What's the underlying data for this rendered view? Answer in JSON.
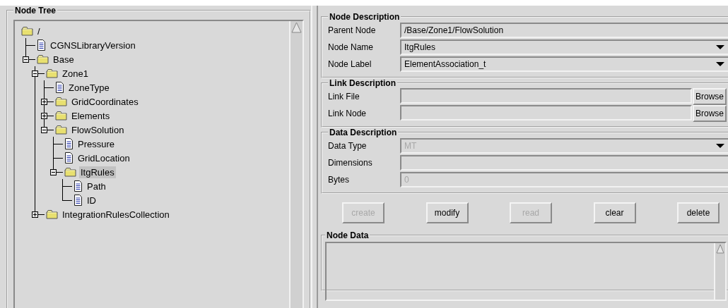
{
  "node_tree": {
    "title": "Node Tree",
    "nodes": [
      {
        "label": "/",
        "kind": "folder",
        "selected": false,
        "children": [
          {
            "label": "CGNSLibraryVersion",
            "kind": "file",
            "selected": false
          },
          {
            "label": "Base",
            "kind": "folder",
            "selected": false,
            "expanded": true,
            "children": [
              {
                "label": "Zone1",
                "kind": "folder",
                "selected": false,
                "expanded": true,
                "children": [
                  {
                    "label": "ZoneType",
                    "kind": "file",
                    "selected": false
                  },
                  {
                    "label": "GridCoordinates",
                    "kind": "folder",
                    "selected": false,
                    "expanded": false
                  },
                  {
                    "label": "Elements",
                    "kind": "folder",
                    "selected": false,
                    "expanded": false
                  },
                  {
                    "label": "FlowSolution",
                    "kind": "folder",
                    "selected": false,
                    "expanded": true,
                    "children": [
                      {
                        "label": "Pressure",
                        "kind": "file",
                        "selected": false
                      },
                      {
                        "label": "GridLocation",
                        "kind": "file",
                        "selected": false
                      },
                      {
                        "label": "ItgRules",
                        "kind": "folder",
                        "selected": true,
                        "expanded": true,
                        "children": [
                          {
                            "label": "Path",
                            "kind": "file",
                            "selected": false
                          },
                          {
                            "label": "ID",
                            "kind": "file",
                            "selected": false
                          }
                        ]
                      }
                    ]
                  }
                ]
              },
              {
                "label": "IntegrationRulesCollection",
                "kind": "folder",
                "selected": false,
                "expanded": false
              }
            ]
          }
        ]
      }
    ]
  },
  "node_description": {
    "title": "Node Description",
    "fields": [
      {
        "label": "Parent Node",
        "kind": "text",
        "value": "/Base/Zone1/FlowSolution",
        "disabled": false
      },
      {
        "label": "Node Name",
        "kind": "combo",
        "value": "ItgRules",
        "disabled": false
      },
      {
        "label": "Node Label",
        "kind": "combo",
        "value": "ElementAssociation_t",
        "disabled": false
      }
    ]
  },
  "link_description": {
    "title": "Link Description",
    "fields": [
      {
        "label": "Link File",
        "kind": "browse",
        "button": "Browse"
      },
      {
        "label": "Link Node",
        "kind": "browse",
        "button": "Browse"
      }
    ]
  },
  "data_description": {
    "title": "Data Description",
    "fields": [
      {
        "label": "Data Type",
        "kind": "combo",
        "value": "MT",
        "disabled": true
      },
      {
        "label": "Dimensions",
        "kind": "text"
      },
      {
        "label": "Bytes",
        "kind": "text",
        "value": "0",
        "disabled": true
      }
    ]
  },
  "buttons": [
    {
      "label": "create",
      "disabled": true
    },
    {
      "label": "modify",
      "disabled": false
    },
    {
      "label": "read",
      "disabled": true
    },
    {
      "label": "clear",
      "disabled": false
    },
    {
      "label": "delete",
      "disabled": false
    }
  ],
  "node_data": {
    "title": "Node Data"
  }
}
